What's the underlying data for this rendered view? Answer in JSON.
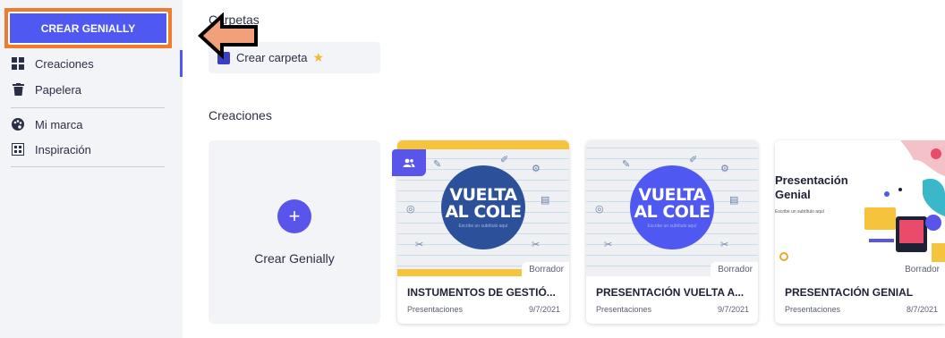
{
  "sidebar": {
    "create_button": "CREAR GENIALLY",
    "items": [
      {
        "label": "Creaciones",
        "icon": "grid-icon"
      },
      {
        "label": "Papelera",
        "icon": "trash-icon"
      },
      {
        "label": "Mi marca",
        "icon": "palette-icon"
      },
      {
        "label": "Inspiración",
        "icon": "inspiration-icon"
      }
    ]
  },
  "main": {
    "folders_title": "Carpetas",
    "create_folder_label": "Crear carpeta",
    "creations_title": "Creaciones",
    "create_card_label": "Crear Genially",
    "cards": [
      {
        "title": "INSTUMENTOS DE GESTIÓ...",
        "type": "Presentaciones",
        "date": "9/7/2021",
        "status": "Borrador",
        "thumb_text": "VUELTA AL COLE",
        "thumb_sub": "Escribe un subtítulo aquí"
      },
      {
        "title": "PRESENTACIÓN VUELTA A...",
        "type": "Presentaciones",
        "date": "9/7/2021",
        "status": "Borrador",
        "thumb_text": "VUELTA AL COLE",
        "thumb_sub": "Escribe un subtítulo aquí"
      },
      {
        "title": "PRESENTACIÓN GENIAL",
        "type": "Presentaciones",
        "date": "8/7/2021",
        "status": "Borrador",
        "thumb_title": "Presentación Genial",
        "thumb_sub": "Escribe un subtítulo aquí"
      }
    ]
  },
  "colors": {
    "accent": "#4f58f0",
    "highlight": "#f07a2e",
    "brand_purple": "#5a55ea"
  }
}
